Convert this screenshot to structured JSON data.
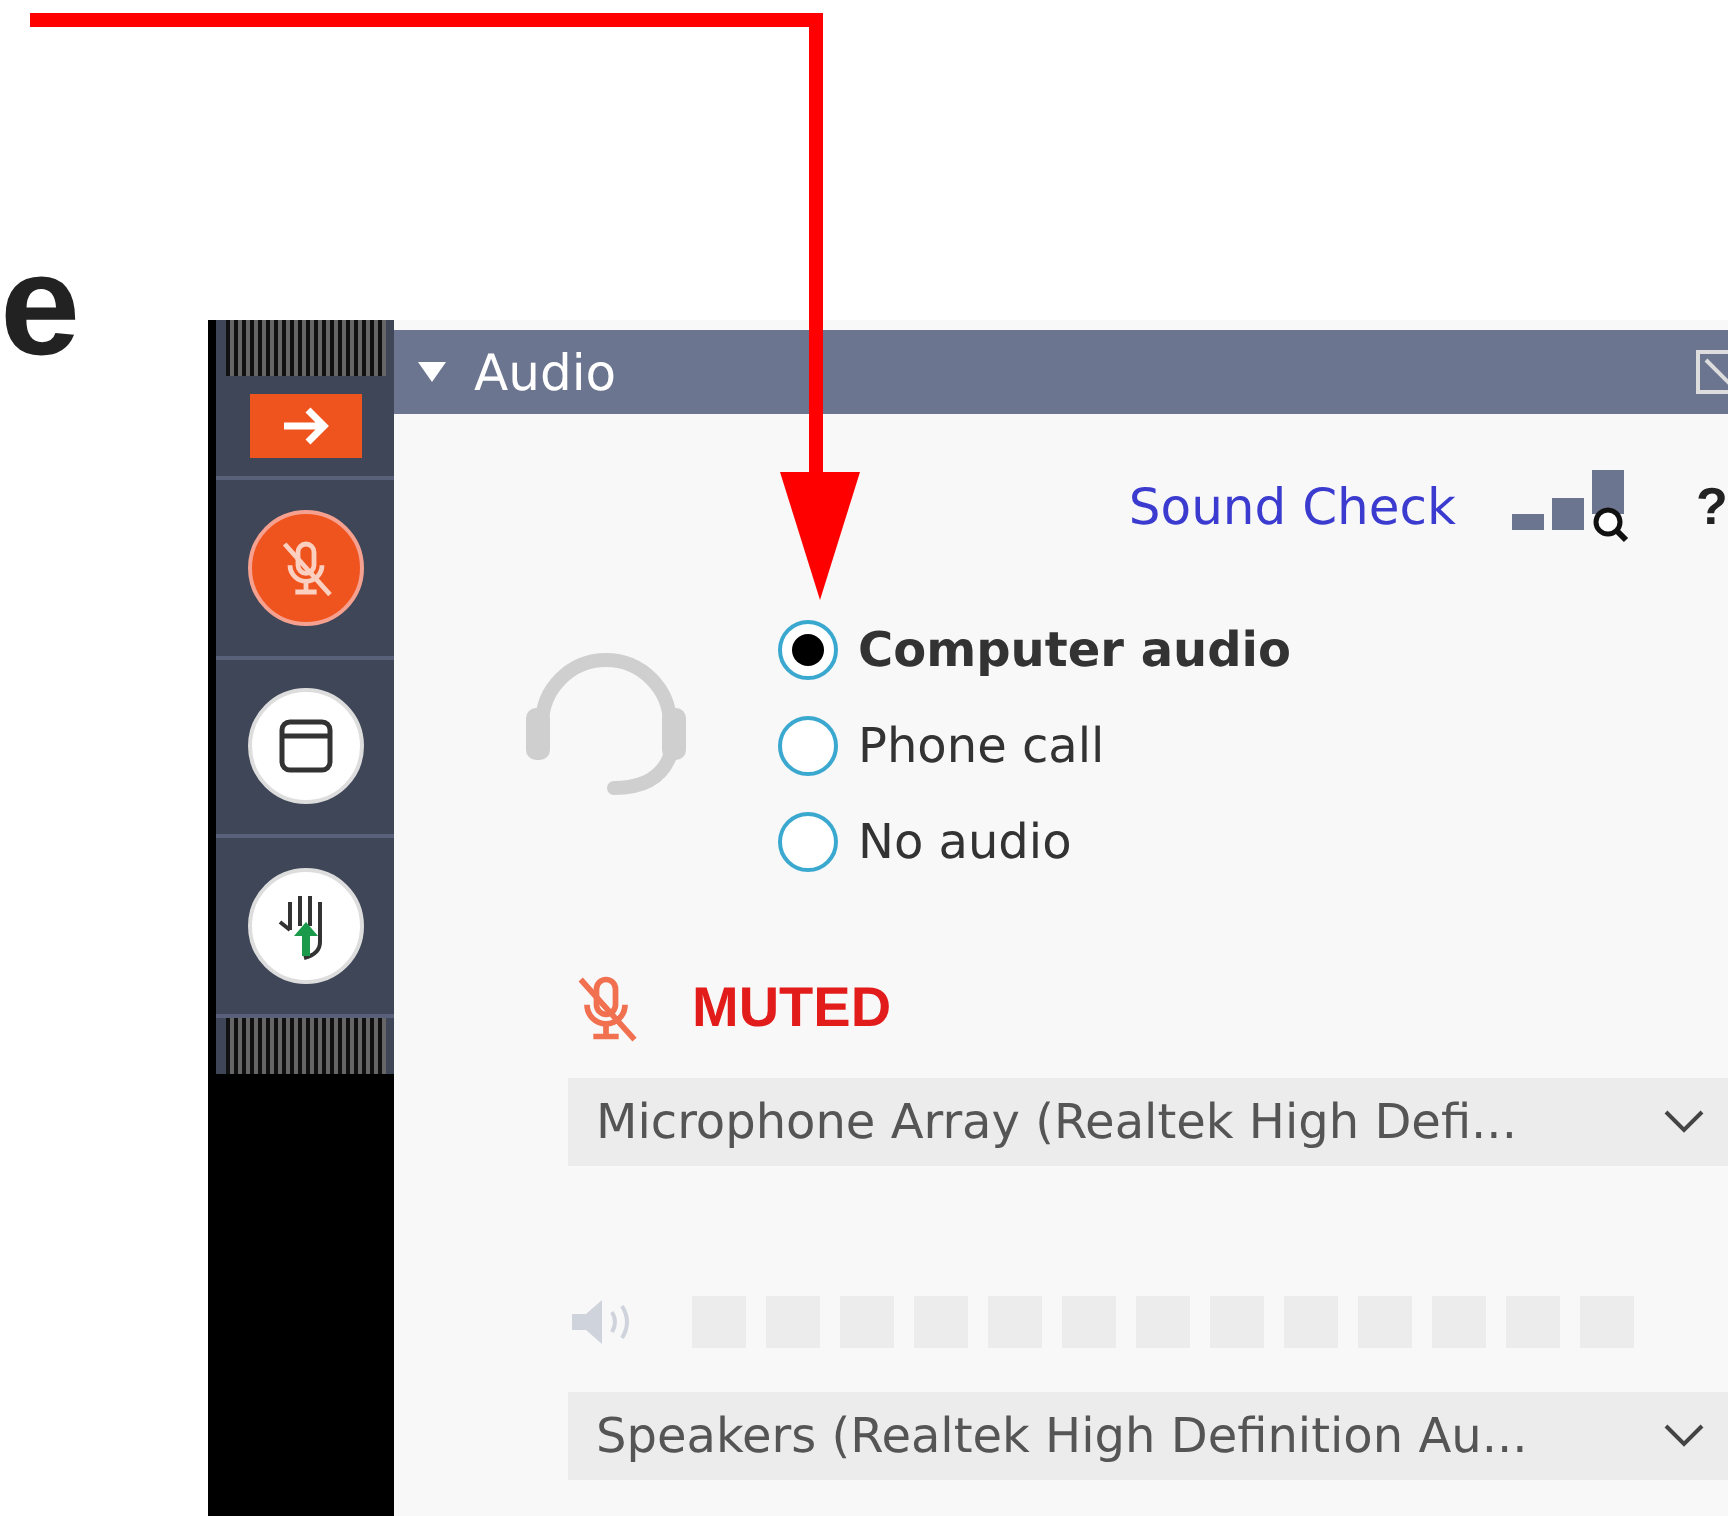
{
  "slide_text": "e",
  "sidebar": {
    "buttons": [
      {
        "kind": "share"
      },
      {
        "kind": "mic",
        "muted": true
      },
      {
        "kind": "window"
      },
      {
        "kind": "hand"
      }
    ]
  },
  "panel": {
    "title": "Audio",
    "expanded": true,
    "sound_check": "Sound Check",
    "help": "?",
    "options": [
      {
        "label": "Computer audio",
        "selected": true
      },
      {
        "label": "Phone call",
        "selected": false
      },
      {
        "label": "No audio",
        "selected": false
      }
    ],
    "mute_status": "MUTED",
    "muted": true,
    "microphone": "Microphone Array (Realtek High Defi...",
    "speakers": "Speakers (Realtek High Definition Au..."
  }
}
